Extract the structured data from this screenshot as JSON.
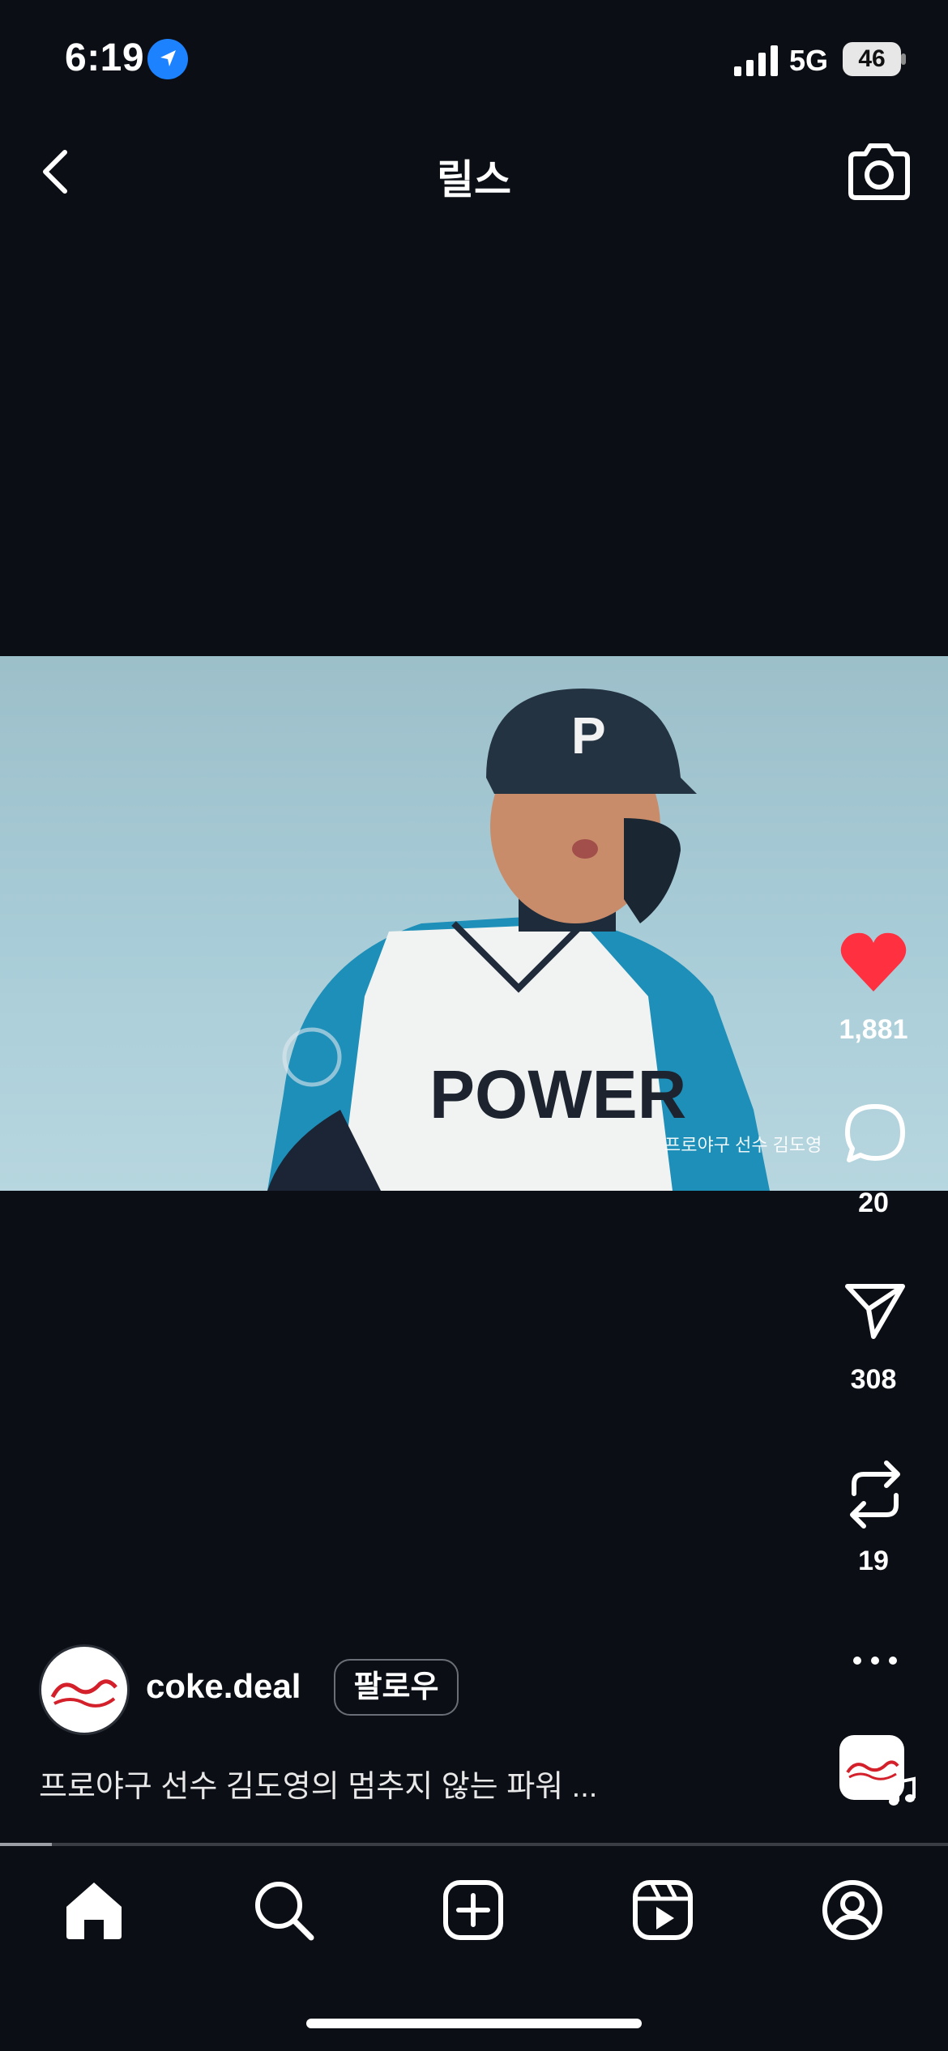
{
  "status_bar": {
    "time": "6:19",
    "network": "5G",
    "battery": "46"
  },
  "header": {
    "title": "릴스"
  },
  "video": {
    "overlay_caption": "프로야구 선수 김도영",
    "jersey_text": "POWER",
    "helmet_letter": "P"
  },
  "actions": {
    "likes": "1,881",
    "comments": "20",
    "shares": "308",
    "remixes": "19"
  },
  "author": {
    "username": "coke.deal",
    "follow_label": "팔로우",
    "logo_text": "Coca-Cola"
  },
  "post": {
    "description": "프로야구 선수 김도영의 멈추지 않는 파워 ..."
  },
  "playback": {
    "progress": 0.055
  },
  "colors": {
    "background": "#0b0e14",
    "like": "#ff3040",
    "location": "#1c82ff"
  },
  "tabs": [
    "home-icon",
    "search-icon",
    "create-icon",
    "reels-icon",
    "profile-icon"
  ]
}
